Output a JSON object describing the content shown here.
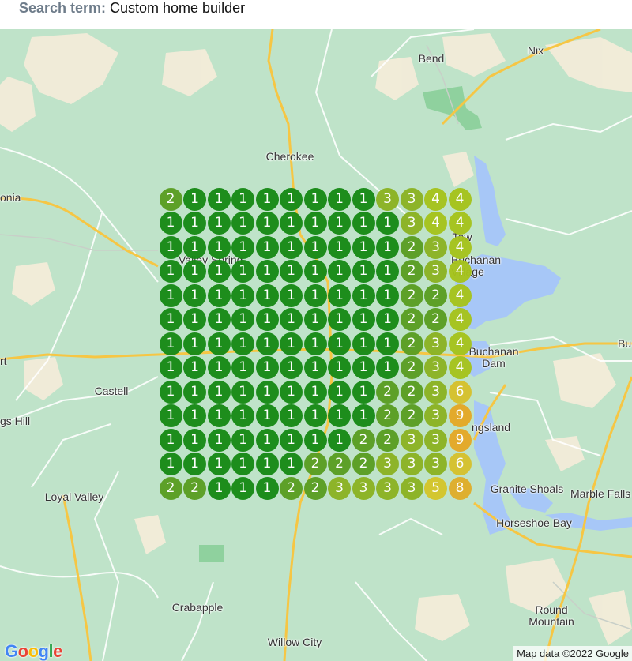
{
  "search": {
    "label": "Search term:",
    "term": "Custom home builder"
  },
  "map": {
    "places": [
      {
        "id": "bend",
        "name": "Bend"
      },
      {
        "id": "nix",
        "name": "Nix"
      },
      {
        "id": "cherokee",
        "name": "Cherokee"
      },
      {
        "id": "llano-partial",
        "name": "onia"
      },
      {
        "id": "valley-spring",
        "name": "Valley Spring"
      },
      {
        "id": "tow",
        "name": "Tow"
      },
      {
        "id": "buchanan-village",
        "name": "Buchanan Village"
      },
      {
        "id": "buchanan-dam",
        "name": "Buchanan Dam"
      },
      {
        "id": "burnet-partial",
        "name": "Bu"
      },
      {
        "id": "pontotoc-partial",
        "name": "rt"
      },
      {
        "id": "castell",
        "name": "Castell"
      },
      {
        "id": "kings-hill",
        "name": "gs Hill"
      },
      {
        "id": "kingsland",
        "name": "ngsland"
      },
      {
        "id": "loyal-valley",
        "name": "Loyal Valley"
      },
      {
        "id": "granite-shoals",
        "name": "Granite Shoals"
      },
      {
        "id": "marble-falls",
        "name": "Marble Falls"
      },
      {
        "id": "horseshoe-bay",
        "name": "Horseshoe Bay"
      },
      {
        "id": "crabapple",
        "name": "Crabapple"
      },
      {
        "id": "round-mountain",
        "name": "Round Mountain"
      },
      {
        "id": "willow-city",
        "name": "Willow City"
      }
    ],
    "colors": {
      "rank1": "#178a16",
      "rank2": "#5a9e22",
      "rank3": "#8bb323",
      "rank4": "#a6c31c",
      "rank5": "#d4c52a",
      "rank6": "#d6c12c",
      "rank8": "#e0ad2a",
      "rank9": "#e5a826"
    },
    "grid_ranks": [
      [
        2,
        1,
        1,
        1,
        1,
        1,
        1,
        1,
        1,
        3,
        3,
        4,
        4
      ],
      [
        1,
        1,
        1,
        1,
        1,
        1,
        1,
        1,
        1,
        1,
        3,
        4,
        4
      ],
      [
        1,
        1,
        1,
        1,
        1,
        1,
        1,
        1,
        1,
        1,
        2,
        3,
        4
      ],
      [
        1,
        1,
        1,
        1,
        1,
        1,
        1,
        1,
        1,
        1,
        2,
        3,
        4
      ],
      [
        1,
        1,
        1,
        1,
        1,
        1,
        1,
        1,
        1,
        1,
        2,
        2,
        4
      ],
      [
        1,
        1,
        1,
        1,
        1,
        1,
        1,
        1,
        1,
        1,
        2,
        2,
        4
      ],
      [
        1,
        1,
        1,
        1,
        1,
        1,
        1,
        1,
        1,
        1,
        2,
        3,
        4
      ],
      [
        1,
        1,
        1,
        1,
        1,
        1,
        1,
        1,
        1,
        1,
        2,
        3,
        4
      ],
      [
        1,
        1,
        1,
        1,
        1,
        1,
        1,
        1,
        1,
        2,
        2,
        3,
        6
      ],
      [
        1,
        1,
        1,
        1,
        1,
        1,
        1,
        1,
        1,
        2,
        2,
        3,
        9
      ],
      [
        1,
        1,
        1,
        1,
        1,
        1,
        1,
        1,
        2,
        2,
        3,
        3,
        9
      ],
      [
        1,
        1,
        1,
        1,
        1,
        1,
        2,
        2,
        2,
        3,
        3,
        3,
        6
      ],
      [
        2,
        2,
        1,
        1,
        1,
        2,
        2,
        3,
        3,
        3,
        3,
        5,
        8
      ]
    ],
    "logo": "Google",
    "attribution": "Map data ©2022 Google"
  }
}
